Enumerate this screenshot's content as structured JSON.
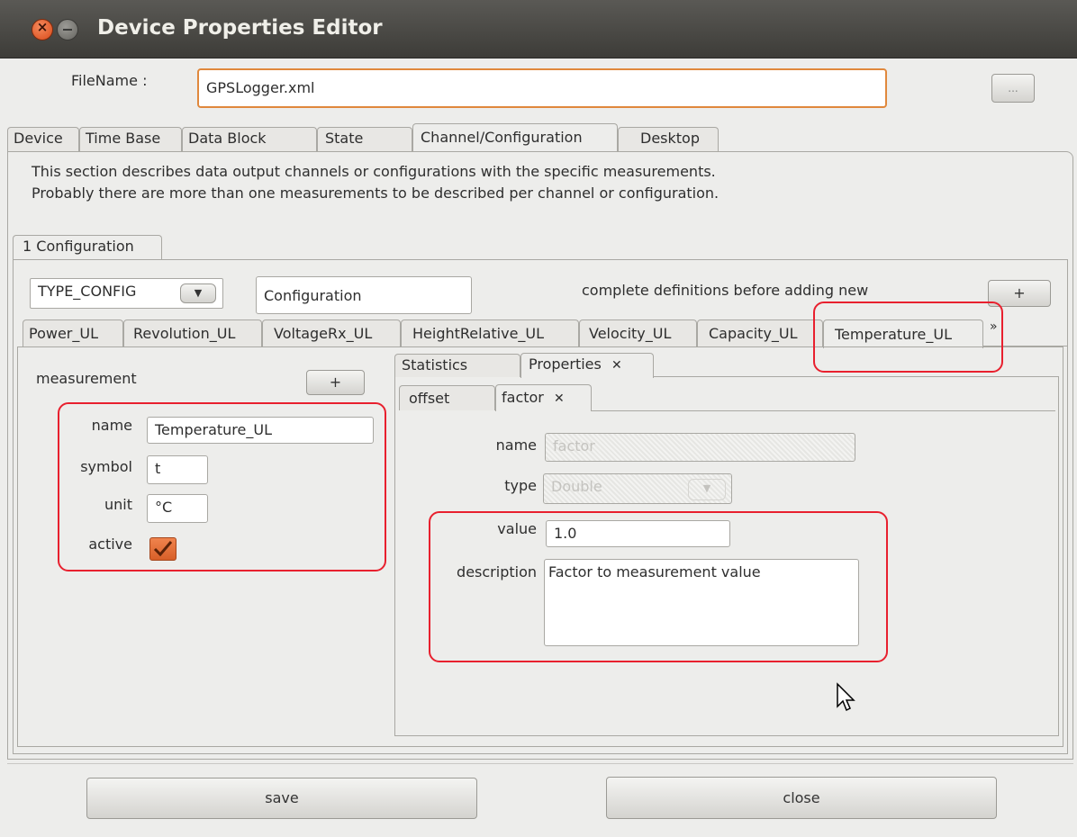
{
  "window": {
    "title": "Device Properties Editor"
  },
  "file": {
    "label": "FileName :",
    "value": "GPSLogger.xml",
    "browse_label": "..."
  },
  "main_tabs": [
    "Device",
    "Time Base",
    "Data Block",
    "State",
    "Channel/Configuration",
    "Desktop"
  ],
  "description": [
    "This section describes data output channels or configurations with the specific measurements.",
    "Probably there are more than one measurements to be described per channel or configuration."
  ],
  "config_tab": "1 Configuration",
  "type_select": {
    "value": "TYPE_CONFIG"
  },
  "config_name": "Configuration",
  "hint": "complete definitions before adding new",
  "add_label": "+",
  "measurement_tabs": [
    "Power_UL",
    "Revolution_UL",
    "VoltageRx_UL",
    "HeightRelative_UL",
    "Velocity_UL",
    "Capacity_UL",
    "Temperature_UL"
  ],
  "more_tabs": "»",
  "measurement": {
    "label": "measurement",
    "add_label": "+",
    "name_label": "name",
    "name_value": "Temperature_UL",
    "symbol_label": "symbol",
    "symbol_value": "t",
    "unit_label": "unit",
    "unit_value": "°C",
    "active_label": "active",
    "active_checked": true
  },
  "detail_tabs": [
    "Statistics",
    "Properties"
  ],
  "property_tabs": [
    "offset",
    "factor"
  ],
  "property": {
    "name_label": "name",
    "name_value": "factor",
    "type_label": "type",
    "type_value": "Double",
    "value_label": "value",
    "value_value": "1.0",
    "description_label": "description",
    "description_value": "Factor to measurement value"
  },
  "buttons": {
    "save": "save",
    "close": "close"
  },
  "colors": {
    "highlight": "#e8202e",
    "checkbox": "#e8703a",
    "filename_border": "#e0883c"
  }
}
